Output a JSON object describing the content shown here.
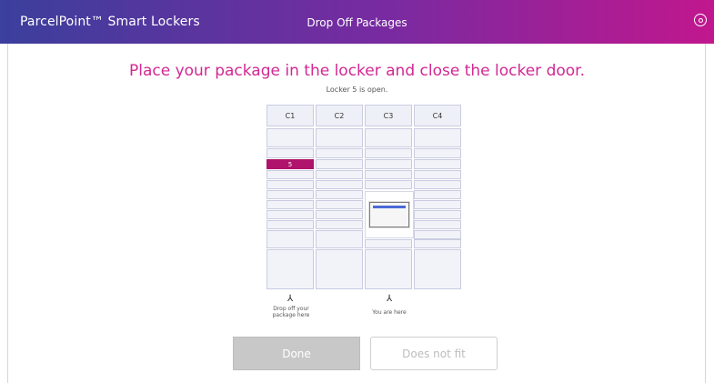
{
  "header": {
    "app_title": "ParcelPoint™ Smart Lockers",
    "page_title": "Drop Off Packages",
    "user_icon": "user-icon"
  },
  "instruction": "Place your package in the locker and close the locker door.",
  "status": "Locker 5 is open.",
  "columns": [
    "C1",
    "C2",
    "C3",
    "C4"
  ],
  "selected_locker_label": "5",
  "markers": [
    {
      "icon": "arrow-icon",
      "label": "Drop off your package here"
    },
    {
      "icon": "arrow-icon",
      "label": "You are here"
    }
  ],
  "buttons": {
    "done": "Done",
    "does_not_fit": "Does not fit"
  },
  "colors": {
    "accent": "#d22893",
    "selected_locker": "#b0136b",
    "header_start": "#3b3f9d",
    "header_end": "#c1178e"
  }
}
